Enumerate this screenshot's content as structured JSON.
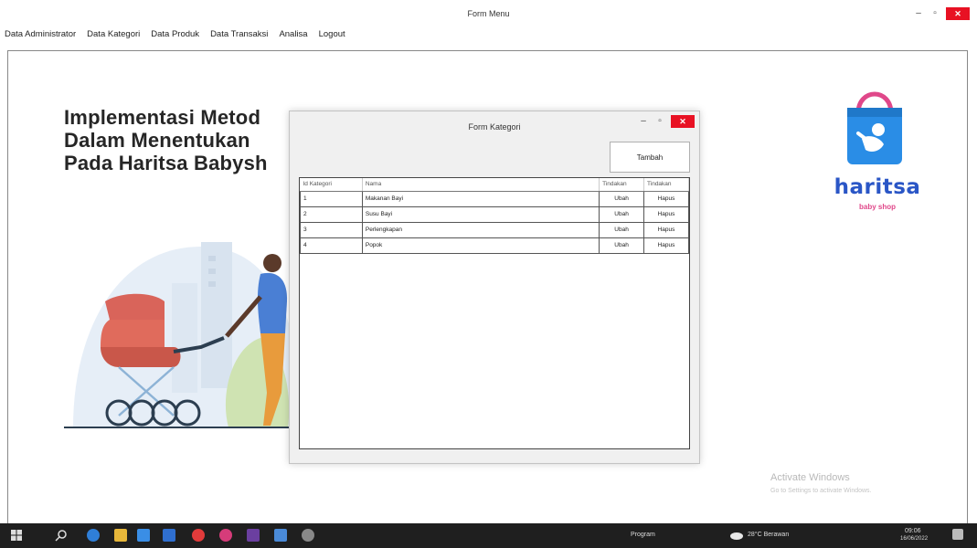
{
  "main_window": {
    "title": "Form Menu",
    "controls": {
      "minimize": "–",
      "maximize": "▫",
      "close": "✕"
    }
  },
  "menu": {
    "items": [
      "Data Administrator",
      "Data Kategori",
      "Data Produk",
      "Data Transaksi",
      "Analisa",
      "Logout"
    ]
  },
  "headline": {
    "line1": "Implementasi Metod",
    "line2": "Dalam Menentukan",
    "line3": "Pada Haritsa Babysh"
  },
  "logo": {
    "name": "haritsa",
    "tagline": "baby shop",
    "icon": "shopping-bag-baby-icon"
  },
  "watermark": {
    "title": "Activate Windows",
    "subtitle": "Go to Settings to activate Windows."
  },
  "dialog": {
    "title": "Form Kategori",
    "controls": {
      "minimize": "–",
      "maximize": "▫",
      "close": "✕"
    },
    "add_button": "Tambah",
    "table": {
      "columns": [
        "Id Kategori",
        "Nama",
        "Tindakan",
        "Tindakan"
      ],
      "rows": [
        {
          "id": "1",
          "nama": "Makanan Bayi",
          "edit": "Ubah",
          "delete": "Hapus"
        },
        {
          "id": "2",
          "nama": "Susu Bayi",
          "edit": "Ubah",
          "delete": "Hapus"
        },
        {
          "id": "3",
          "nama": "Perlengkapan",
          "edit": "Ubah",
          "delete": "Hapus"
        },
        {
          "id": "4",
          "nama": "Popok",
          "edit": "Ubah",
          "delete": "Hapus"
        }
      ]
    }
  },
  "taskbar": {
    "program_label": "Program",
    "weather": "28°C Berawan",
    "time": "09:06",
    "date": "16/06/2022"
  },
  "colors": {
    "close_red": "#e81123",
    "logo_blue": "#2a56c6",
    "logo_pink": "#e0488a",
    "taskbar": "#1f1f1f"
  }
}
